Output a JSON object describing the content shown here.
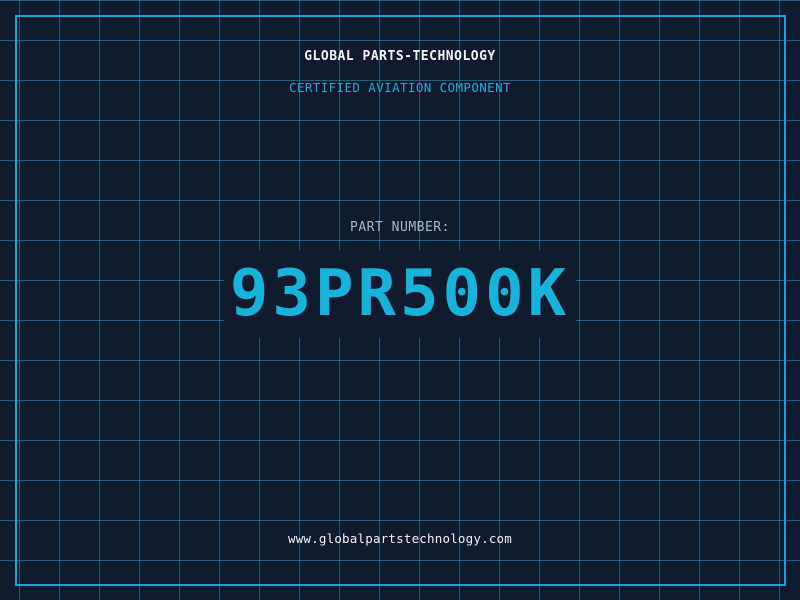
{
  "header": {
    "company": "GLOBAL PARTS-TECHNOLOGY",
    "subtitle": "CERTIFIED AVIATION COMPONENT"
  },
  "part": {
    "label": "PART NUMBER:",
    "number": "93PR500K"
  },
  "footer": {
    "website": "www.globalpartstechnology.com"
  },
  "colors": {
    "background": "#111a2e",
    "grid": "#2896b9",
    "accent": "#16b3da",
    "text": "#f2f4f7"
  }
}
